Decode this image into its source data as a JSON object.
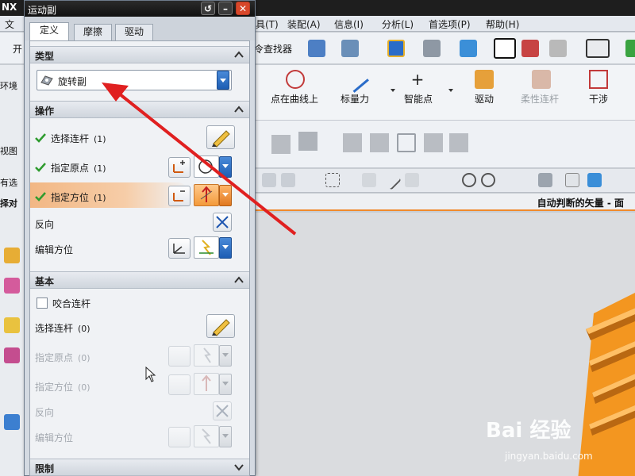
{
  "app": {
    "title": "NX",
    "menu": [
      "文",
      "具(T)",
      "装配(A)",
      "信息(I)",
      "分析(L)",
      "首选项(P)",
      "帮助(H)"
    ],
    "toolbar": {
      "command_finder": "令查找器",
      "left_partial": "开"
    },
    "ribbon": {
      "point_on_curve": "点在曲线上",
      "marker_force": "标量力",
      "smart_point": "智能点",
      "drive": "驱动",
      "flexible_link": "柔性连杆",
      "interference": "干涉",
      "env_partial": "环境",
      "view_partial": "视图"
    },
    "left_partial_labels": [
      "有选",
      "择对"
    ],
    "vector_label": "自动判断的矢量 - 面"
  },
  "dialog": {
    "title": "运动副",
    "tabs": [
      "定义",
      "摩擦",
      "驱动"
    ],
    "active_tab": 0,
    "sections": {
      "type": {
        "title": "类型",
        "selected": "旋转副"
      },
      "action": {
        "title": "操作",
        "rows": [
          {
            "label": "选择连杆",
            "count": "(1)",
            "done": true
          },
          {
            "label": "指定原点",
            "count": "(1)",
            "done": true
          },
          {
            "label": "指定方位",
            "count": "(1)",
            "done": true,
            "active": true
          },
          {
            "label": "反向"
          },
          {
            "label": "编辑方位"
          }
        ]
      },
      "base": {
        "title": "基本",
        "mesh_checkbox": "咬合连杆",
        "rows": [
          {
            "label": "选择连杆",
            "count": "(0)"
          },
          {
            "label": "指定原点",
            "count": "(0)"
          },
          {
            "label": "指定方位",
            "count": "(0)"
          },
          {
            "label": "反向"
          },
          {
            "label": "编辑方位"
          }
        ]
      },
      "limit": {
        "title": "限制"
      }
    }
  },
  "watermark": {
    "brand": "Bai 经验",
    "url": "jingyan.baidu.com"
  },
  "colors": {
    "accent_orange": "#f08a2c",
    "highlight": "#f4c193",
    "arrow_red": "#e02020",
    "check_green": "#2e9b2e"
  }
}
